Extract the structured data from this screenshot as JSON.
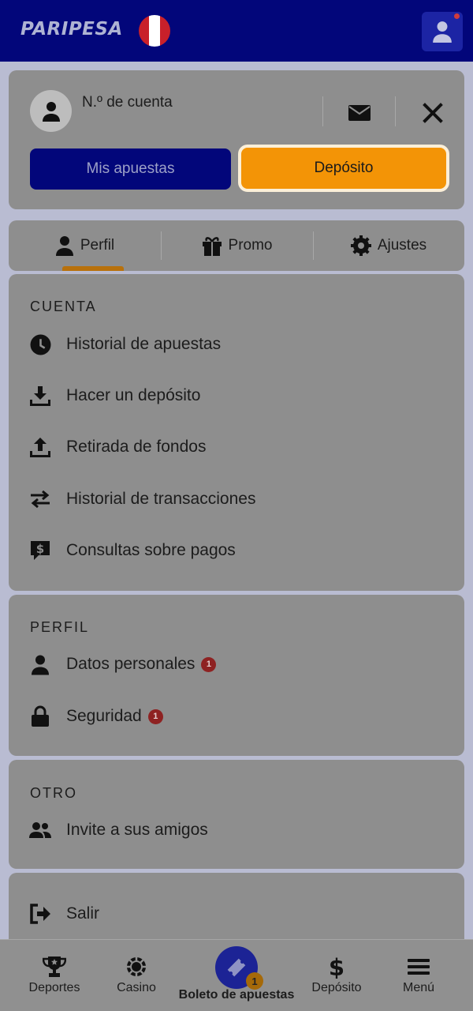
{
  "header": {
    "logo_text": "PARIPESA",
    "flag_colors": [
      "#c8202a",
      "#ffffff",
      "#c8202a"
    ]
  },
  "account": {
    "label": "N.º de cuenta",
    "my_bets_label": "Mis apuestas",
    "deposit_label": "Depósito"
  },
  "tabs": [
    {
      "label": "Perfil",
      "icon": "person-icon",
      "active": true
    },
    {
      "label": "Promo",
      "icon": "gift-icon",
      "active": false
    },
    {
      "label": "Ajustes",
      "icon": "gear-icon",
      "active": false
    }
  ],
  "sections": {
    "cuenta": {
      "title": "CUENTA",
      "items": [
        {
          "label": "Historial de apuestas",
          "icon": "clock-icon"
        },
        {
          "label": "Hacer un depósito",
          "icon": "download-tray-icon"
        },
        {
          "label": "Retirada de fondos",
          "icon": "upload-tray-icon"
        },
        {
          "label": "Historial de transacciones",
          "icon": "swap-arrows-icon"
        },
        {
          "label": "Consultas sobre pagos",
          "icon": "dollar-chat-icon"
        }
      ]
    },
    "perfil": {
      "title": "PERFIL",
      "items": [
        {
          "label": "Datos personales",
          "icon": "person-icon",
          "badge": "1"
        },
        {
          "label": "Seguridad",
          "icon": "lock-icon",
          "badge": "1"
        }
      ]
    },
    "otro": {
      "title": "OTRO",
      "items": [
        {
          "label": "Invite a sus amigos",
          "icon": "people-icon"
        }
      ]
    },
    "logout": {
      "label": "Salir",
      "icon": "logout-icon"
    }
  },
  "bottom_nav": [
    {
      "label": "Deportes",
      "icon": "trophy-icon"
    },
    {
      "label": "Casino",
      "icon": "casino-chip-icon"
    },
    {
      "label": "Boleto de apuestas",
      "icon": "ticket-icon",
      "badge": "1"
    },
    {
      "label": "Depósito",
      "icon": "dollar-icon"
    },
    {
      "label": "Menú",
      "icon": "hamburger-icon"
    }
  ],
  "colors": {
    "header_bg": "#02067a",
    "deposit_accent": "#f39406",
    "badge_red": "#8e2222"
  }
}
